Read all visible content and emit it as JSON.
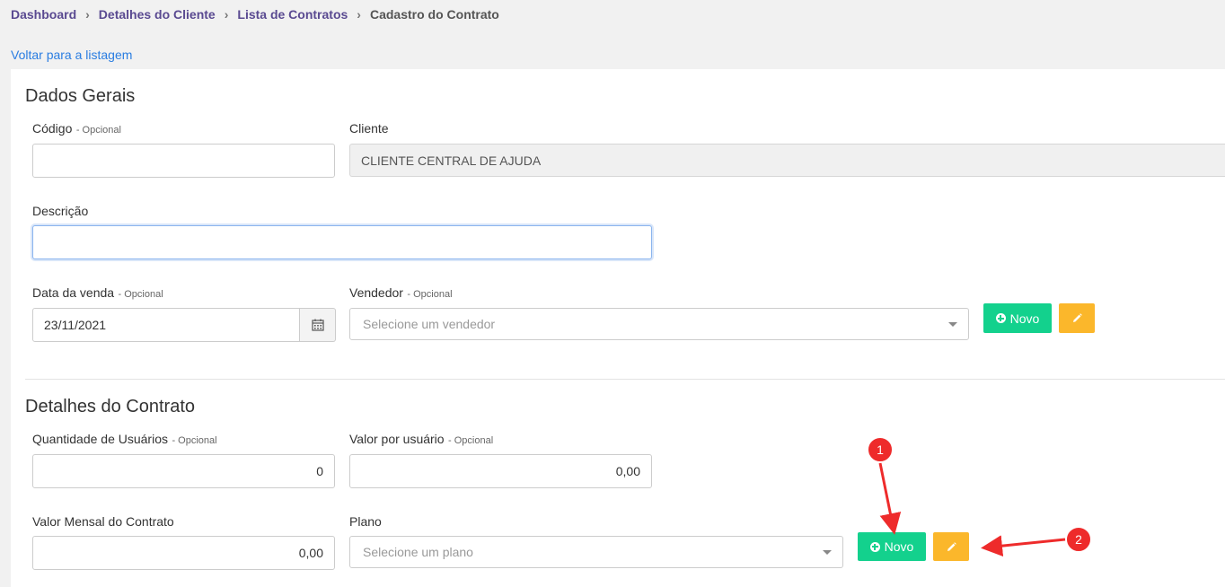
{
  "breadcrumb": {
    "items": [
      "Dashboard",
      "Detalhes do Cliente",
      "Lista de Contratos"
    ],
    "current": "Cadastro do Contrato",
    "separator": "›"
  },
  "back_link": "Voltar para a listagem",
  "dados_gerais": {
    "title": "Dados Gerais",
    "codigo": {
      "label": "Código",
      "optional": "- Opcional",
      "value": ""
    },
    "cliente": {
      "label": "Cliente",
      "value": "CLIENTE CENTRAL DE AJUDA"
    },
    "descricao": {
      "label": "Descrição",
      "value": ""
    },
    "data_venda": {
      "label": "Data da venda",
      "optional": "- Opcional",
      "value": "23/11/2021"
    },
    "vendedor": {
      "label": "Vendedor",
      "optional": "- Opcional",
      "placeholder": "Selecione um vendedor"
    },
    "novo_label": "Novo"
  },
  "detalhes_contrato": {
    "title": "Detalhes do Contrato",
    "quantidade": {
      "label": "Quantidade de Usuários",
      "optional": "- Opcional",
      "value": "0"
    },
    "valor_usuario": {
      "label": "Valor por usuário",
      "optional": "- Opcional",
      "value": "0,00"
    },
    "valor_mensal": {
      "label": "Valor Mensal do Contrato",
      "value": "0,00"
    },
    "plano": {
      "label": "Plano",
      "placeholder": "Selecione um plano"
    },
    "novo_label": "Novo"
  },
  "annotations": {
    "marker_1": "1",
    "marker_2": "2"
  },
  "colors": {
    "accent_green": "#13d18d",
    "accent_orange": "#fbb72b",
    "breadcrumb_purple": "#5a4a91",
    "link_blue": "#2a7de1",
    "annotation_red": "#ee2b2b"
  }
}
